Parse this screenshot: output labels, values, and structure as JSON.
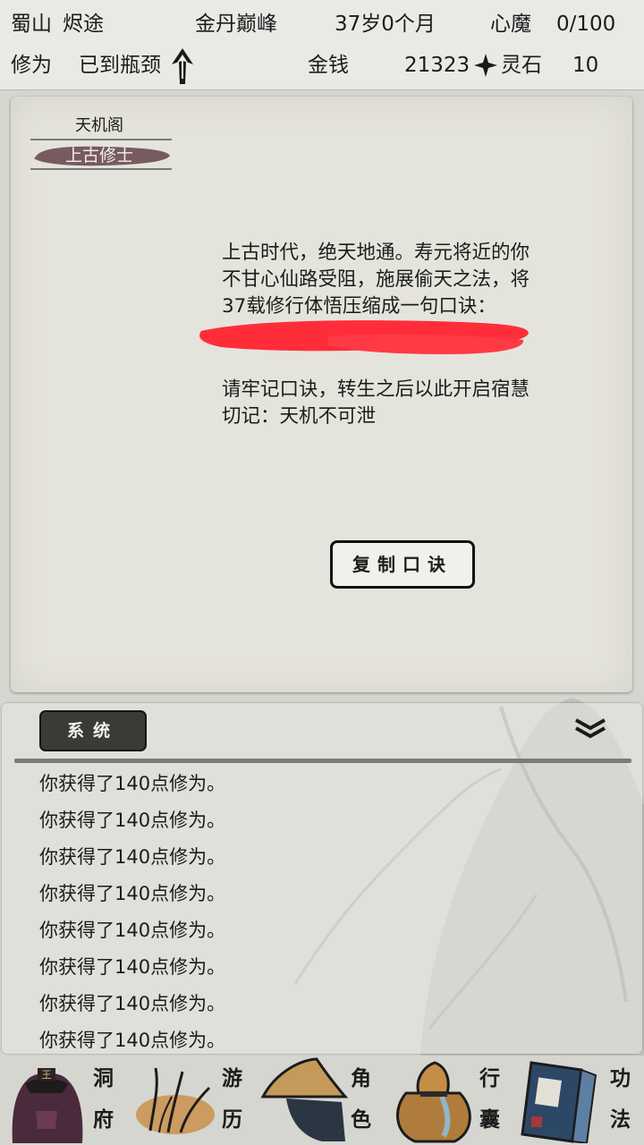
{
  "topbar": {
    "sect": "蜀山",
    "sect_title": "烬途",
    "realm": "金丹巅峰",
    "age": "37岁0个月",
    "demon_label": "心魔",
    "demon_value": "0/100",
    "cultivation_label": "修为",
    "cultivation_status": "已到瓶颈",
    "money_label": "金钱",
    "money_value": "21323",
    "spirit_stone_label": "灵石",
    "spirit_stone_value": "10"
  },
  "panel": {
    "section_title": "天机阁",
    "active_tab": "上古修士",
    "story_lines": [
      "上古时代，绝天地通。寿元将近的你",
      "不甘心仙路受阻，施展偷天之法，将",
      "37载修行体悟压缩成一句口诀："
    ],
    "note_lines": [
      "请牢记口诀，转生之后以此开启宿慧",
      "切记：天机不可泄"
    ],
    "copy_button": "复制口诀"
  },
  "log": {
    "tab_label": "系统",
    "entries": [
      "你获得了140点修为。",
      "你获得了140点修为。",
      "你获得了140点修为。",
      "你获得了140点修为。",
      "你获得了140点修为。",
      "你获得了140点修为。",
      "你获得了140点修为。",
      "你获得了140点修为。"
    ]
  },
  "nav": {
    "items": [
      {
        "top": "洞",
        "bottom": "府",
        "icon": "cave-icon"
      },
      {
        "top": "游",
        "bottom": "历",
        "icon": "grass-icon"
      },
      {
        "top": "角",
        "bottom": "色",
        "icon": "straw-hat-icon"
      },
      {
        "top": "行",
        "bottom": "囊",
        "icon": "bag-icon"
      },
      {
        "top": "功",
        "bottom": "法",
        "icon": "book-icon"
      }
    ]
  },
  "colors": {
    "panel_bg": "#e5e4dc",
    "tab_brush": "#6e4f55",
    "redaction": "#ff2d3a",
    "button_dark": "#3c3a37"
  }
}
